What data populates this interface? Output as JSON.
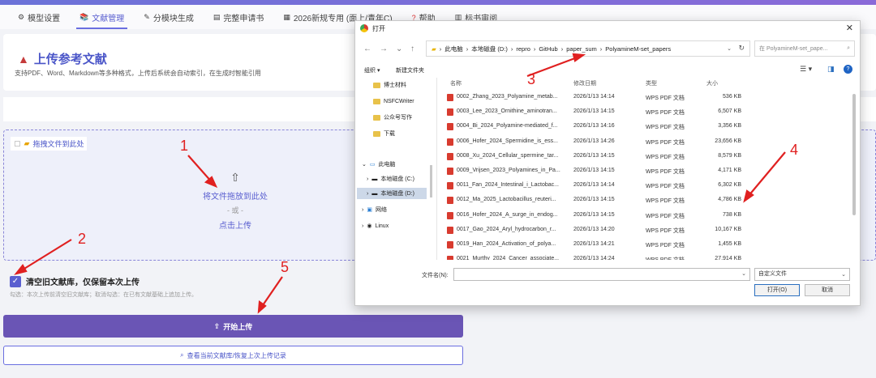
{
  "tabs": [
    {
      "label": "模型设置",
      "icon": "gear-icon"
    },
    {
      "label": "文献管理",
      "icon": "book-icon"
    },
    {
      "label": "分模块生成",
      "icon": "wand-icon"
    },
    {
      "label": "完整申请书",
      "icon": "document-icon"
    },
    {
      "label": "2026新规专用 (面上/青年C)",
      "icon": "calendar-icon"
    },
    {
      "label": "帮助",
      "icon": "question-icon"
    },
    {
      "label": "标书审阅",
      "icon": "clipboard-icon"
    }
  ],
  "upload_card": {
    "title": "上传参考文献",
    "description": "支持PDF、Word、Markdown等多种格式，上传后系统会自动索引，在生成时智能引用"
  },
  "drop_zone": {
    "tag": "拖拽文件到此处",
    "main": "将文件拖放到此处",
    "or": "- 或 -",
    "click": "点击上传"
  },
  "clear_library": {
    "label": "清空旧文献库，仅保留本次上传",
    "checked": true,
    "hint": "勾选：本次上传前清空旧文献库；取消勾选：在已有文献基础上追加上传。"
  },
  "buttons": {
    "start_upload": "开始上传",
    "view_library": "查看当前文献库/恢复上次上传记录"
  },
  "dialog": {
    "title": "打开",
    "close": "✕",
    "breadcrumb": [
      "此电脑",
      "本地磁盘 (D:)",
      "repro",
      "GitHub",
      "paper_sum",
      "PolyamineM-set_papers"
    ],
    "search_placeholder": "在 PolyamineM-set_pape...",
    "toolbar": {
      "organize": "组织 ▾",
      "new_folder": "新建文件夹"
    },
    "sidebar": [
      {
        "label": "博士材料",
        "type": "folder"
      },
      {
        "label": "NSFCWriter",
        "type": "folder"
      },
      {
        "label": "公众号写作",
        "type": "folder"
      },
      {
        "label": "下载",
        "type": "folder"
      },
      {
        "label": "此电脑",
        "type": "pc"
      },
      {
        "label": "本地磁盘 (C:)",
        "type": "drive"
      },
      {
        "label": "本地磁盘 (D:)",
        "type": "drive"
      },
      {
        "label": "网络",
        "type": "network"
      },
      {
        "label": "Linux",
        "type": "linux"
      }
    ],
    "columns": {
      "name": "名称",
      "date": "修改日期",
      "type": "类型",
      "size": "大小"
    },
    "files": [
      {
        "name": "0002_Zhang_2023_Polyamine_metab...",
        "date": "2026/1/13 14:14",
        "type": "WPS PDF 文档",
        "size": "536 KB"
      },
      {
        "name": "0003_Lee_2023_Ornithine_aminotran...",
        "date": "2026/1/13 14:15",
        "type": "WPS PDF 文档",
        "size": "6,507 KB"
      },
      {
        "name": "0004_Bi_2024_Polyamine-mediated_f...",
        "date": "2026/1/13 14:16",
        "type": "WPS PDF 文档",
        "size": "3,356 KB"
      },
      {
        "name": "0006_Hofer_2024_Spermidine_is_ess...",
        "date": "2026/1/13 14:26",
        "type": "WPS PDF 文档",
        "size": "23,656 KB"
      },
      {
        "name": "0008_Xu_2024_Cellular_spermine_tar...",
        "date": "2026/1/13 14:15",
        "type": "WPS PDF 文档",
        "size": "8,579 KB"
      },
      {
        "name": "0009_Vrijsen_2023_Polyamines_in_Pa...",
        "date": "2026/1/13 14:15",
        "type": "WPS PDF 文档",
        "size": "4,171 KB"
      },
      {
        "name": "0011_Fan_2024_Intestinal_i_Lactobac...",
        "date": "2026/1/13 14:14",
        "type": "WPS PDF 文档",
        "size": "6,302 KB"
      },
      {
        "name": "0012_Ma_2025_Lactobacillus_reuteri...",
        "date": "2026/1/13 14:15",
        "type": "WPS PDF 文档",
        "size": "4,786 KB"
      },
      {
        "name": "0016_Hofer_2024_A_surge_in_endog...",
        "date": "2026/1/13 14:15",
        "type": "WPS PDF 文档",
        "size": "738 KB"
      },
      {
        "name": "0017_Gao_2024_Aryl_hydrocarbon_r...",
        "date": "2026/1/13 14:20",
        "type": "WPS PDF 文档",
        "size": "10,167 KB"
      },
      {
        "name": "0019_Han_2024_Activation_of_polya...",
        "date": "2026/1/13 14:21",
        "type": "WPS PDF 文档",
        "size": "1,455 KB"
      },
      {
        "name": "0021_Murthy_2024_Cancer_associate...",
        "date": "2026/1/13 14:24",
        "type": "WPS PDF 文档",
        "size": "27,914 KB"
      }
    ],
    "filename_label": "文件名(N):",
    "filter": "自定义文件",
    "open_button": "打开(O)",
    "cancel_button": "取消"
  },
  "annotations": [
    "1",
    "2",
    "3",
    "4",
    "5"
  ],
  "colors": {
    "accent": "#5a5fd0",
    "annotation": "#e02020",
    "start_button": "#6a55b5"
  }
}
